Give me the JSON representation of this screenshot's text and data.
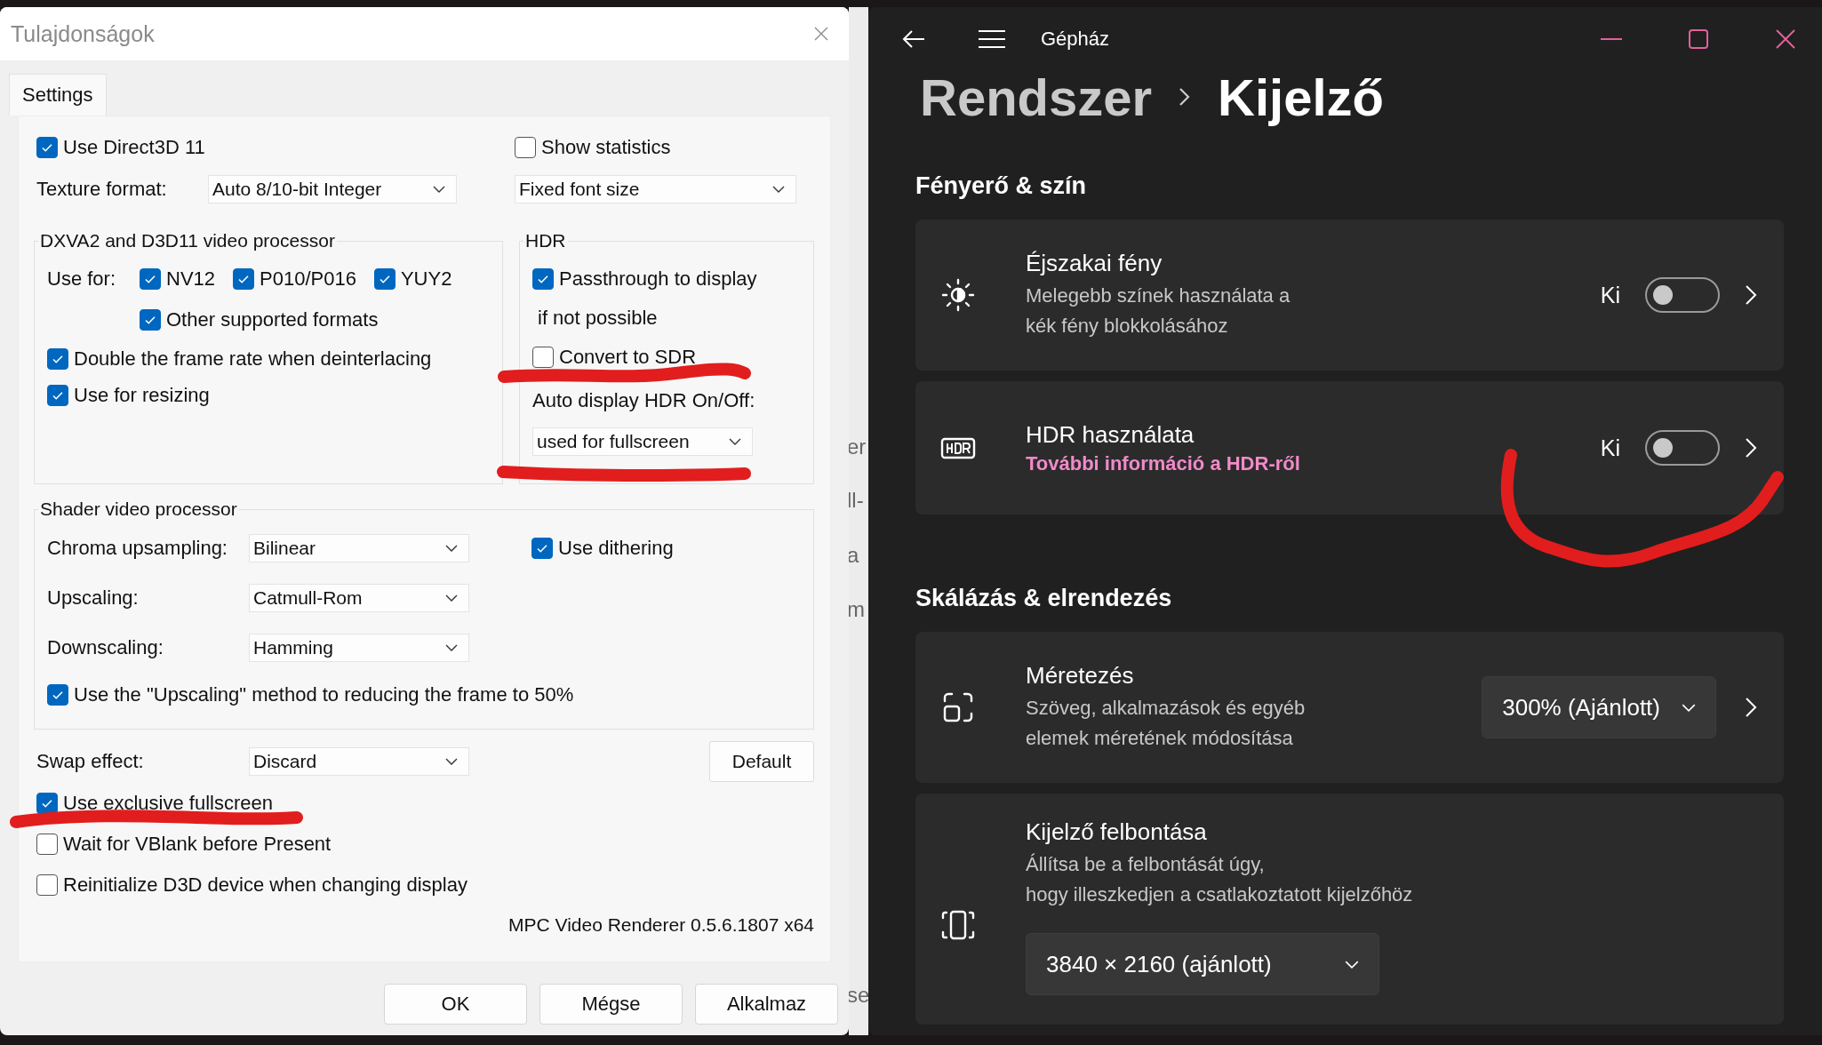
{
  "background_window": {
    "fragments": [
      "er",
      "ll-",
      "a",
      "m",
      "se"
    ]
  },
  "dialog": {
    "title": "Tulajdonságok",
    "tabs": [
      {
        "label": "Settings",
        "selected": true
      }
    ],
    "use_direct3d": {
      "label": "Use Direct3D 11",
      "checked": true
    },
    "show_statistics": {
      "label": "Show statistics",
      "checked": false
    },
    "texture_format": {
      "label": "Texture format:",
      "value": "Auto 8/10-bit Integer"
    },
    "statistics_font": {
      "value": "Fixed font size"
    },
    "dxva_group": {
      "title": "DXVA2 and D3D11 video processor",
      "use_for_label": "Use for:",
      "formats": [
        {
          "label": "NV12",
          "checked": true
        },
        {
          "label": "P010/P016",
          "checked": true
        },
        {
          "label": "YUY2",
          "checked": true
        },
        {
          "label": "Other supported formats",
          "checked": true
        }
      ],
      "options": [
        {
          "label": "Double the frame rate when deinterlacing",
          "checked": true
        },
        {
          "label": "Use for resizing",
          "checked": true
        }
      ]
    },
    "hdr_group": {
      "title": "HDR",
      "passthrough": {
        "label": "Passthrough to display",
        "checked": true
      },
      "fallback_label": "if not possible",
      "convert": {
        "label": "Convert to SDR",
        "checked": false
      },
      "auto_label": "Auto display HDR On/Off:",
      "auto_value": "used for fullscreen"
    },
    "shader_group": {
      "title": "Shader video processor",
      "selects": [
        {
          "label": "Chroma upsampling:",
          "value": "Bilinear"
        },
        {
          "label": "Upscaling:",
          "value": "Catmull-Rom"
        },
        {
          "label": "Downscaling:",
          "value": "Hamming"
        }
      ],
      "dithering": {
        "label": "Use dithering",
        "checked": true
      },
      "downscale_option": {
        "label": "Use the \"Upscaling\" method to reducing the frame to 50%",
        "checked": true
      }
    },
    "swap_effect": {
      "label": "Swap effect:",
      "value": "Discard"
    },
    "default_button": "Default",
    "options": [
      {
        "label": "Use exclusive fullscreen",
        "checked": true
      },
      {
        "label": "Wait for VBlank before Present",
        "checked": false
      },
      {
        "label": "Reinitialize D3D device when changing display",
        "checked": false
      }
    ],
    "version": "MPC Video Renderer 0.5.6.1807 x64",
    "buttons": [
      "OK",
      "Mégse",
      "Alkalmaz"
    ]
  },
  "settings": {
    "app_title": "Gépház",
    "breadcrumb": [
      "Rendszer",
      "Kijelző"
    ],
    "sections": [
      {
        "title": "Fényerő & szín",
        "cards": [
          {
            "kind": "toggle",
            "title": "Éjszakai fény",
            "description_lines": [
              "Melegebb színek használata a",
              "kék fény blokkolásához"
            ],
            "state_label": "Ki",
            "on": false
          },
          {
            "kind": "toggle",
            "title": "HDR használata",
            "link": "További információ a HDR-ről",
            "state_label": "Ki",
            "on": false
          }
        ]
      },
      {
        "title": "Skálázás & elrendezés",
        "cards": [
          {
            "kind": "select",
            "title": "Méretezés",
            "description_lines": [
              "Szöveg, alkalmazások és egyéb",
              "elemek méretének módosítása"
            ],
            "value": "300% (Ajánlott)"
          },
          {
            "kind": "select_below",
            "title": "Kijelző felbontása",
            "description_lines": [
              "Állítsa be a felbontását úgy,",
              "hogy illeszkedjen a csatlakoztatott kijelzőhöz"
            ],
            "value": "3840 × 2160 (ajánlott)"
          }
        ]
      }
    ]
  }
}
